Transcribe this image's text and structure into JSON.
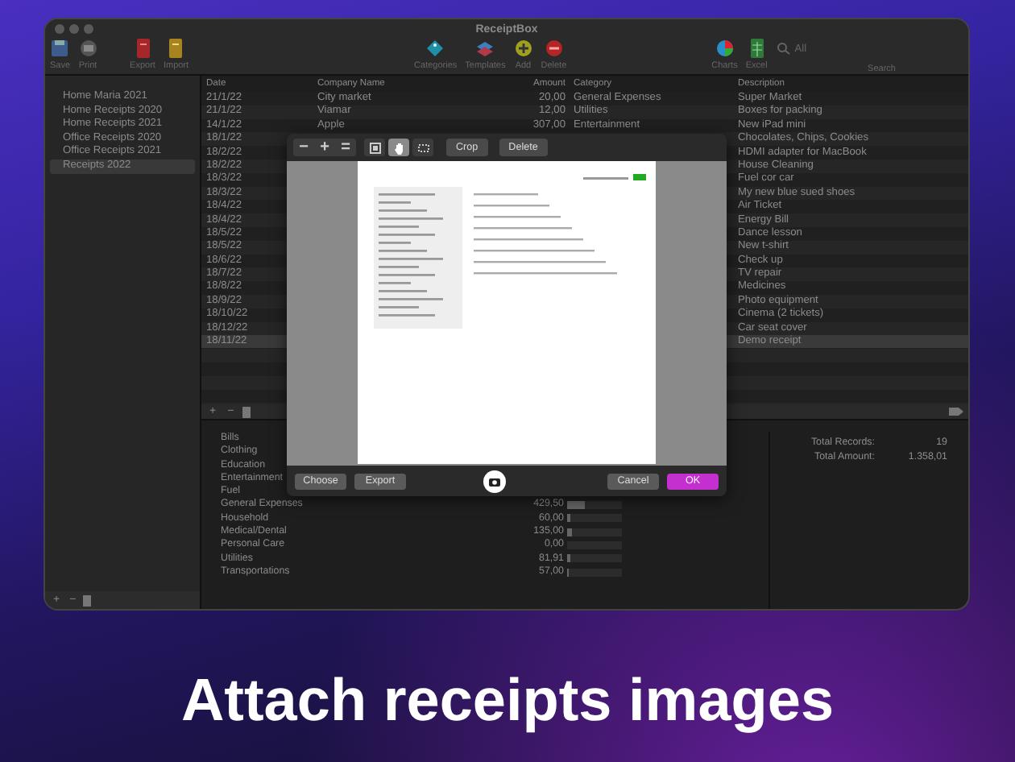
{
  "window": {
    "title": "ReceiptBox"
  },
  "toolbar": {
    "left": [
      {
        "label": "Save"
      },
      {
        "label": "Print"
      },
      {
        "label": "Export"
      },
      {
        "label": "Import"
      }
    ],
    "center": [
      {
        "label": "Categories"
      },
      {
        "label": "Templates"
      },
      {
        "label": "Add"
      },
      {
        "label": "Delete"
      }
    ],
    "right": [
      {
        "label": "Charts"
      },
      {
        "label": "Excel"
      }
    ],
    "filter": "All",
    "search_label": "Search"
  },
  "sidebar": {
    "items": [
      {
        "label": "Home Maria 2021",
        "selected": false
      },
      {
        "label": "Home Receipts 2020",
        "selected": false
      },
      {
        "label": "Home Receipts 2021",
        "selected": false
      },
      {
        "label": "Office Receipts 2020",
        "selected": false
      },
      {
        "label": "Office Receipts 2021",
        "selected": false
      },
      {
        "label": "Receipts 2022",
        "selected": true
      }
    ],
    "buttons": [
      "+",
      "−"
    ]
  },
  "table": {
    "columns": [
      "Date",
      "Company Name",
      "Amount",
      "Category",
      "Description"
    ],
    "rows": [
      {
        "date": "21/1/22",
        "company": "City market",
        "amount": "20,00",
        "category": "General Expenses",
        "description": "Super Market",
        "selected": false
      },
      {
        "date": "21/1/22",
        "company": "Viamar",
        "amount": "12,00",
        "category": "Utilities",
        "description": "Boxes for packing",
        "selected": false
      },
      {
        "date": "14/1/22",
        "company": "Apple",
        "amount": "307,00",
        "category": "Entertainment",
        "description": "New iPad mini",
        "selected": false
      },
      {
        "date": "18/1/22",
        "description": "Chocolates, Chips, Cookies",
        "selected": false
      },
      {
        "date": "18/2/22",
        "description": "HDMI adapter for MacBook",
        "selected": false
      },
      {
        "date": "18/2/22",
        "description": "House Cleaning",
        "selected": false
      },
      {
        "date": "18/3/22",
        "description": "Fuel cor car",
        "selected": false
      },
      {
        "date": "18/3/22",
        "description": "My new blue sued shoes",
        "selected": false
      },
      {
        "date": "18/4/22",
        "description": "Air Ticket",
        "selected": false
      },
      {
        "date": "18/4/22",
        "description": "Energy Bill",
        "selected": false
      },
      {
        "date": "18/5/22",
        "description": "Dance lesson",
        "selected": false
      },
      {
        "date": "18/5/22",
        "description": "New t-shirt",
        "selected": false
      },
      {
        "date": "18/6/22",
        "description": "Check up",
        "selected": false
      },
      {
        "date": "18/7/22",
        "description": "TV repair",
        "selected": false
      },
      {
        "date": "18/8/22",
        "description": "Medicines",
        "selected": false
      },
      {
        "date": "18/9/22",
        "description": "Photo equipment",
        "selected": false
      },
      {
        "date": "18/10/22",
        "description": "Cinema (2 tickets)",
        "selected": false
      },
      {
        "date": "18/12/22",
        "description": "Car seat cover",
        "selected": false
      },
      {
        "date": "18/11/22",
        "description": "Demo receipt",
        "selected": true
      }
    ],
    "buttons": [
      "+",
      "−"
    ]
  },
  "summary": {
    "categories": [
      {
        "name": "Bills"
      },
      {
        "name": "Clothing"
      },
      {
        "name": "Education"
      },
      {
        "name": "Entertainment"
      },
      {
        "name": "Fuel"
      },
      {
        "name": "General Expenses",
        "amount": "429,50",
        "level": 0.32
      },
      {
        "name": "Household",
        "amount": "60,00",
        "level": 0.05
      },
      {
        "name": "Medical/Dental",
        "amount": "135,00",
        "level": 0.1
      },
      {
        "name": "Personal Care",
        "amount": "0,00",
        "level": 0
      },
      {
        "name": "Utilities",
        "amount": "81,91",
        "level": 0.06
      },
      {
        "name": "Transportations",
        "amount": "57,00",
        "level": 0.04
      }
    ],
    "totals": [
      {
        "label": "Total Records:",
        "value": "19"
      },
      {
        "label": "Total Amount:",
        "value": "1.358,01"
      }
    ]
  },
  "image_dialog": {
    "zoom_buttons": [
      "−",
      "+",
      "="
    ],
    "view_tools": [
      {
        "selected": false
      },
      {
        "selected": true
      },
      {
        "selected": false
      }
    ],
    "actions": [
      "Crop",
      "Delete"
    ],
    "left_buttons": [
      "Choose",
      "Export"
    ],
    "right_buttons": [
      {
        "label": "Cancel",
        "primary": false
      },
      {
        "label": "OK",
        "primary": true
      }
    ]
  },
  "caption": "Attach receipts images"
}
